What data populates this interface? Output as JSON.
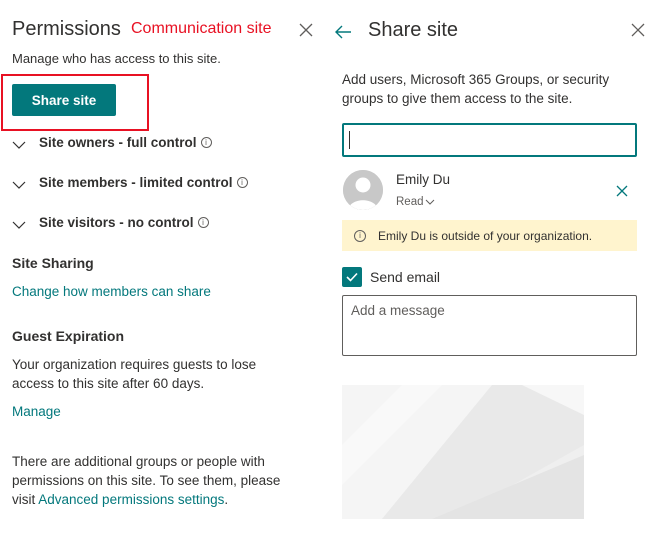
{
  "permissions_panel": {
    "title": "Permissions",
    "annotation": "Communication site",
    "description": "Manage who has access to this site.",
    "share_button_label": "Share site",
    "groups": [
      {
        "label": "Site owners - full control"
      },
      {
        "label": "Site members - limited control"
      },
      {
        "label": "Site visitors - no control"
      }
    ],
    "info_glyph": "i",
    "site_sharing": {
      "heading": "Site Sharing",
      "link": "Change how members can share"
    },
    "guest_expiration": {
      "heading": "Guest Expiration",
      "text": "Your organization requires guests to lose access to this site after 60 days.",
      "link": "Manage"
    },
    "footer": {
      "text_before": "There are additional groups or people with permissions on this site. To see them, please visit ",
      "link": "Advanced permissions settings",
      "text_after": "."
    }
  },
  "share_panel": {
    "title": "Share site",
    "description": "Add users, Microsoft 365 Groups, or security groups to give them access to the site.",
    "search_value": "",
    "person": {
      "name": "Emily Du",
      "role": "Read"
    },
    "notice": "Emily Du is outside of your organization.",
    "send_email_label": "Send email",
    "send_email_checked": true,
    "message_placeholder": "Add a message"
  },
  "icons": {
    "close": "close-icon",
    "back": "back-arrow-icon",
    "chevron": "chevron-down-icon",
    "info": "info-icon",
    "checkmark": "checkmark-icon",
    "avatar": "person-avatar-icon"
  },
  "colors": {
    "accent": "#03787c",
    "annotation_red": "#e81123",
    "text": "#323130",
    "notice_bg": "#fff4ce"
  }
}
